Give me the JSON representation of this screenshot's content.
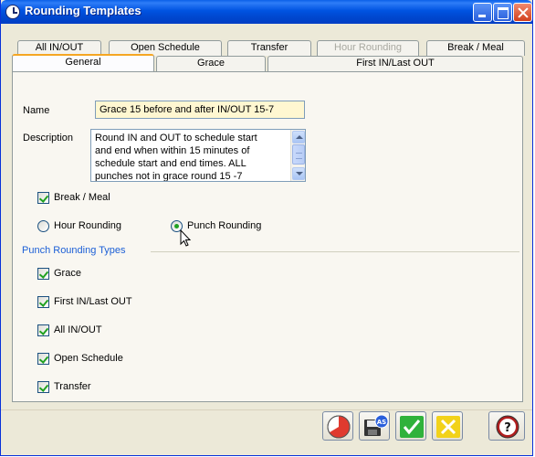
{
  "window": {
    "title": "Rounding Templates"
  },
  "tabs": {
    "back_row": [
      {
        "label": "All IN/OUT",
        "disabled": false
      },
      {
        "label": "Open Schedule",
        "disabled": false
      },
      {
        "label": "Transfer",
        "disabled": false
      },
      {
        "label": "Hour Rounding",
        "disabled": true
      },
      {
        "label": "Break / Meal",
        "disabled": false
      }
    ],
    "front_row": [
      {
        "label": "General",
        "active": true
      },
      {
        "label": "Grace",
        "active": false
      },
      {
        "label": "First IN/Last OUT",
        "active": false
      }
    ]
  },
  "form": {
    "name_label": "Name",
    "name_value": "Grace 15 before and after IN/OUT 15-7",
    "description_label": "Description",
    "description_lines": [
      "Round IN and OUT to schedule start",
      "and end when within 15 minutes of",
      "schedule start and end times. ALL",
      "punches not in grace round 15 -7"
    ],
    "break_meal": {
      "label": "Break / Meal",
      "checked": true
    },
    "rounding_mode": {
      "options": [
        {
          "label": "Hour Rounding",
          "selected": false
        },
        {
          "label": "Punch Rounding",
          "selected": true
        }
      ]
    },
    "punch_rounding_types": {
      "title": "Punch Rounding Types",
      "items": [
        {
          "label": "Grace",
          "checked": true
        },
        {
          "label": "First IN/Last OUT",
          "checked": true
        },
        {
          "label": "All IN/OUT",
          "checked": true
        },
        {
          "label": "Open Schedule",
          "checked": true
        },
        {
          "label": "Transfer",
          "checked": true
        }
      ]
    }
  },
  "toolbar": {
    "buttons": [
      {
        "name": "clock-pie-icon",
        "color": "#e03a2f"
      },
      {
        "name": "save-as-icon",
        "color": "#2a5fdb"
      },
      {
        "name": "ok-check-icon",
        "color": "#2fb23b"
      },
      {
        "name": "cancel-x-icon",
        "color": "#f2d21a"
      },
      {
        "name": "help-icon",
        "color": "#b01e1e"
      }
    ]
  },
  "colors": {
    "title_bar": "#0048d0",
    "accent_tab": "#f5a623",
    "group_title": "#1c5fd6",
    "name_field_bg": "#fff7d1"
  }
}
